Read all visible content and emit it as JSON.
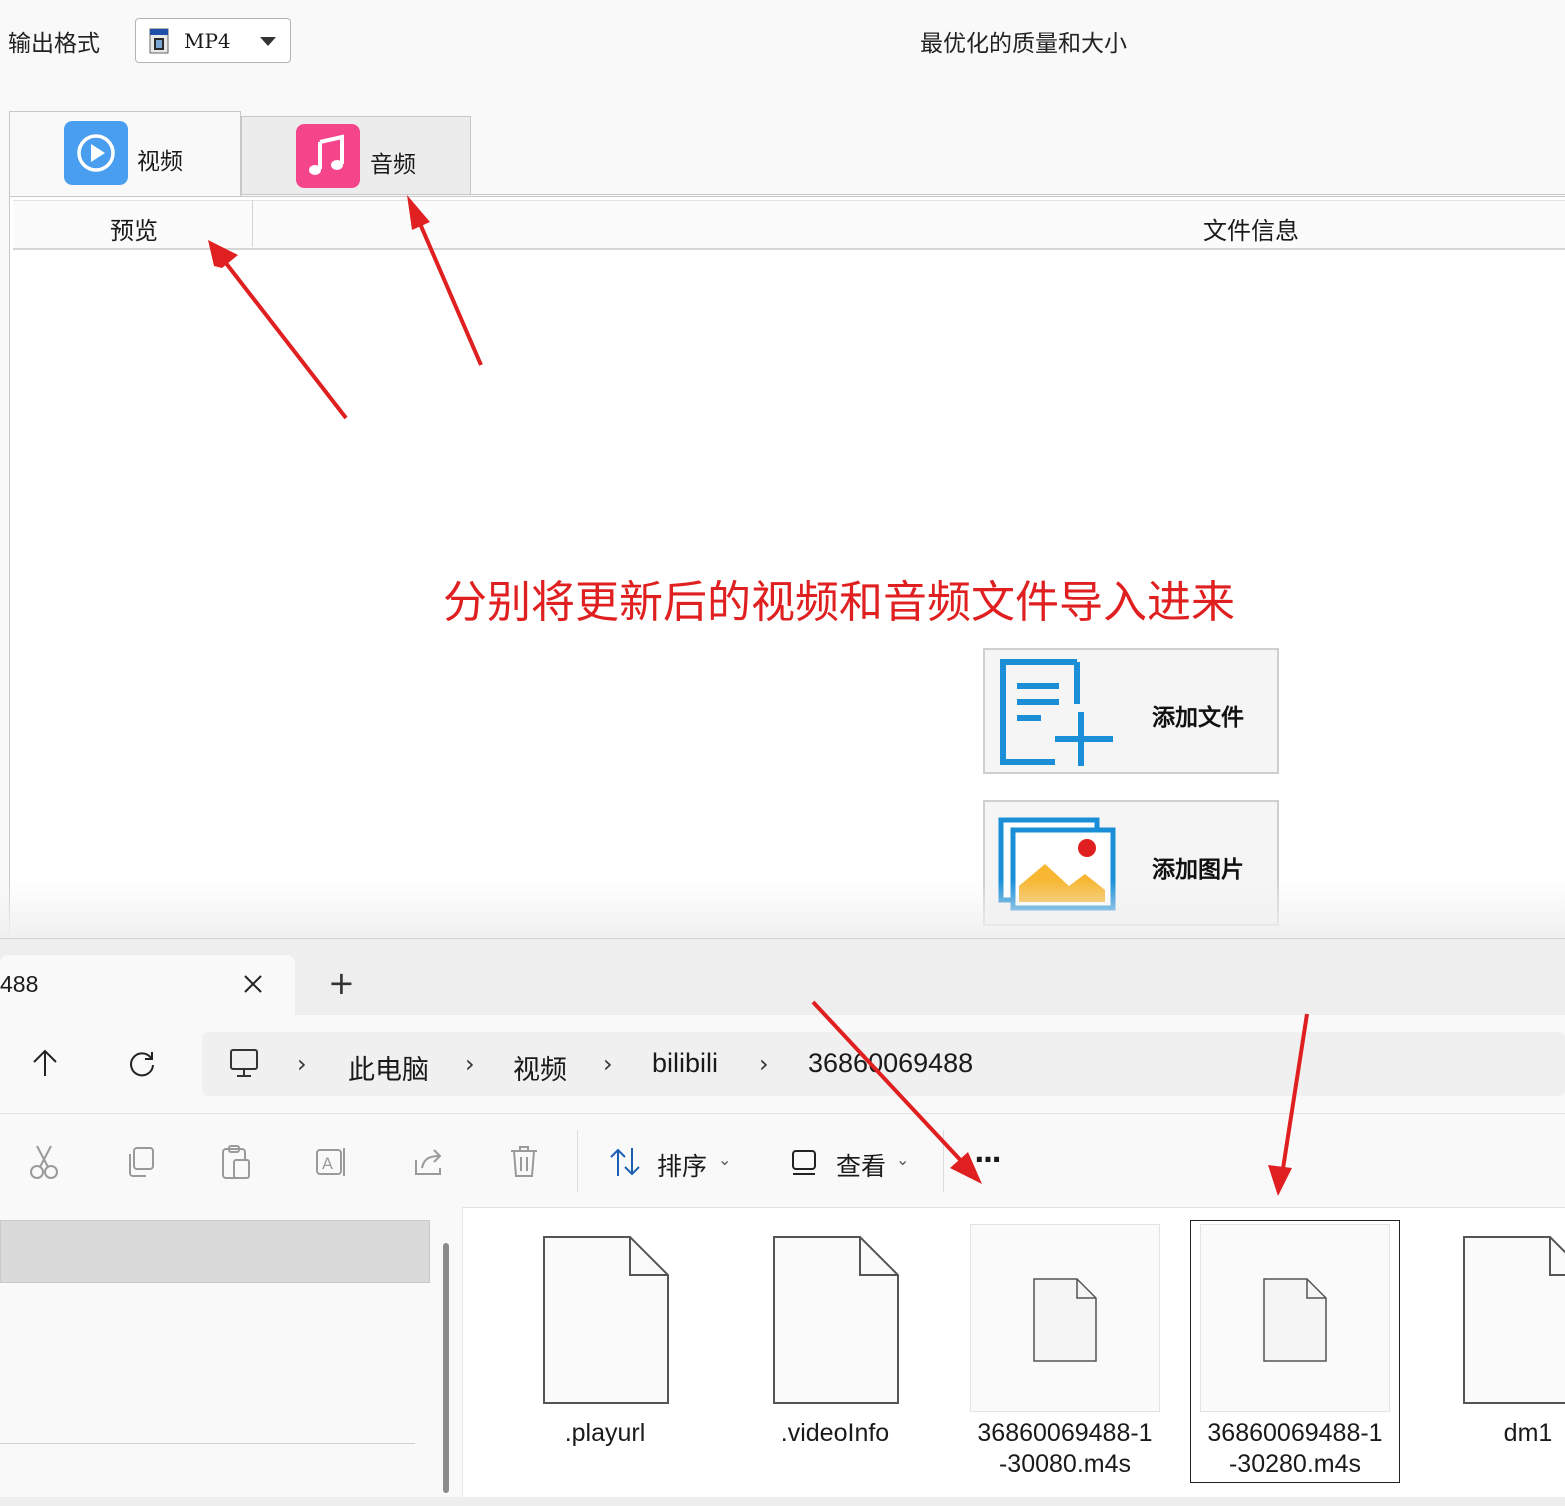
{
  "converter": {
    "output_format_label": "输出格式",
    "format_value": "MP4",
    "quality_text": "最优化的质量和大小",
    "tabs": [
      {
        "label": "视频",
        "icon": "play-circle-icon",
        "color": "#4a9ef0"
      },
      {
        "label": "音频",
        "icon": "music-note-icon",
        "color": "#f5458a"
      }
    ],
    "columns": {
      "preview": "预览",
      "file_info": "文件信息"
    },
    "annotation": "分别将更新后的视频和音频文件导入进来",
    "annotation_color": "#e02020",
    "buttons": {
      "add_file": "添加文件",
      "add_image": "添加图片"
    },
    "accent_color": "#1a8fd8"
  },
  "explorer": {
    "tab_title": "488",
    "new_tab": "+",
    "breadcrumbs": [
      "此电脑",
      "视频",
      "bilibili",
      "36860069488"
    ],
    "toolbar": {
      "sort": "排序",
      "view": "查看",
      "more": "···"
    },
    "files": [
      {
        "name": ".playurl"
      },
      {
        "name": ".videoInfo"
      },
      {
        "name_line1": "36860069488-1",
        "name_line2": "-30080.m4s"
      },
      {
        "name_line1": "36860069488-1",
        "name_line2": "-30280.m4s"
      },
      {
        "name": "dm1"
      }
    ]
  }
}
